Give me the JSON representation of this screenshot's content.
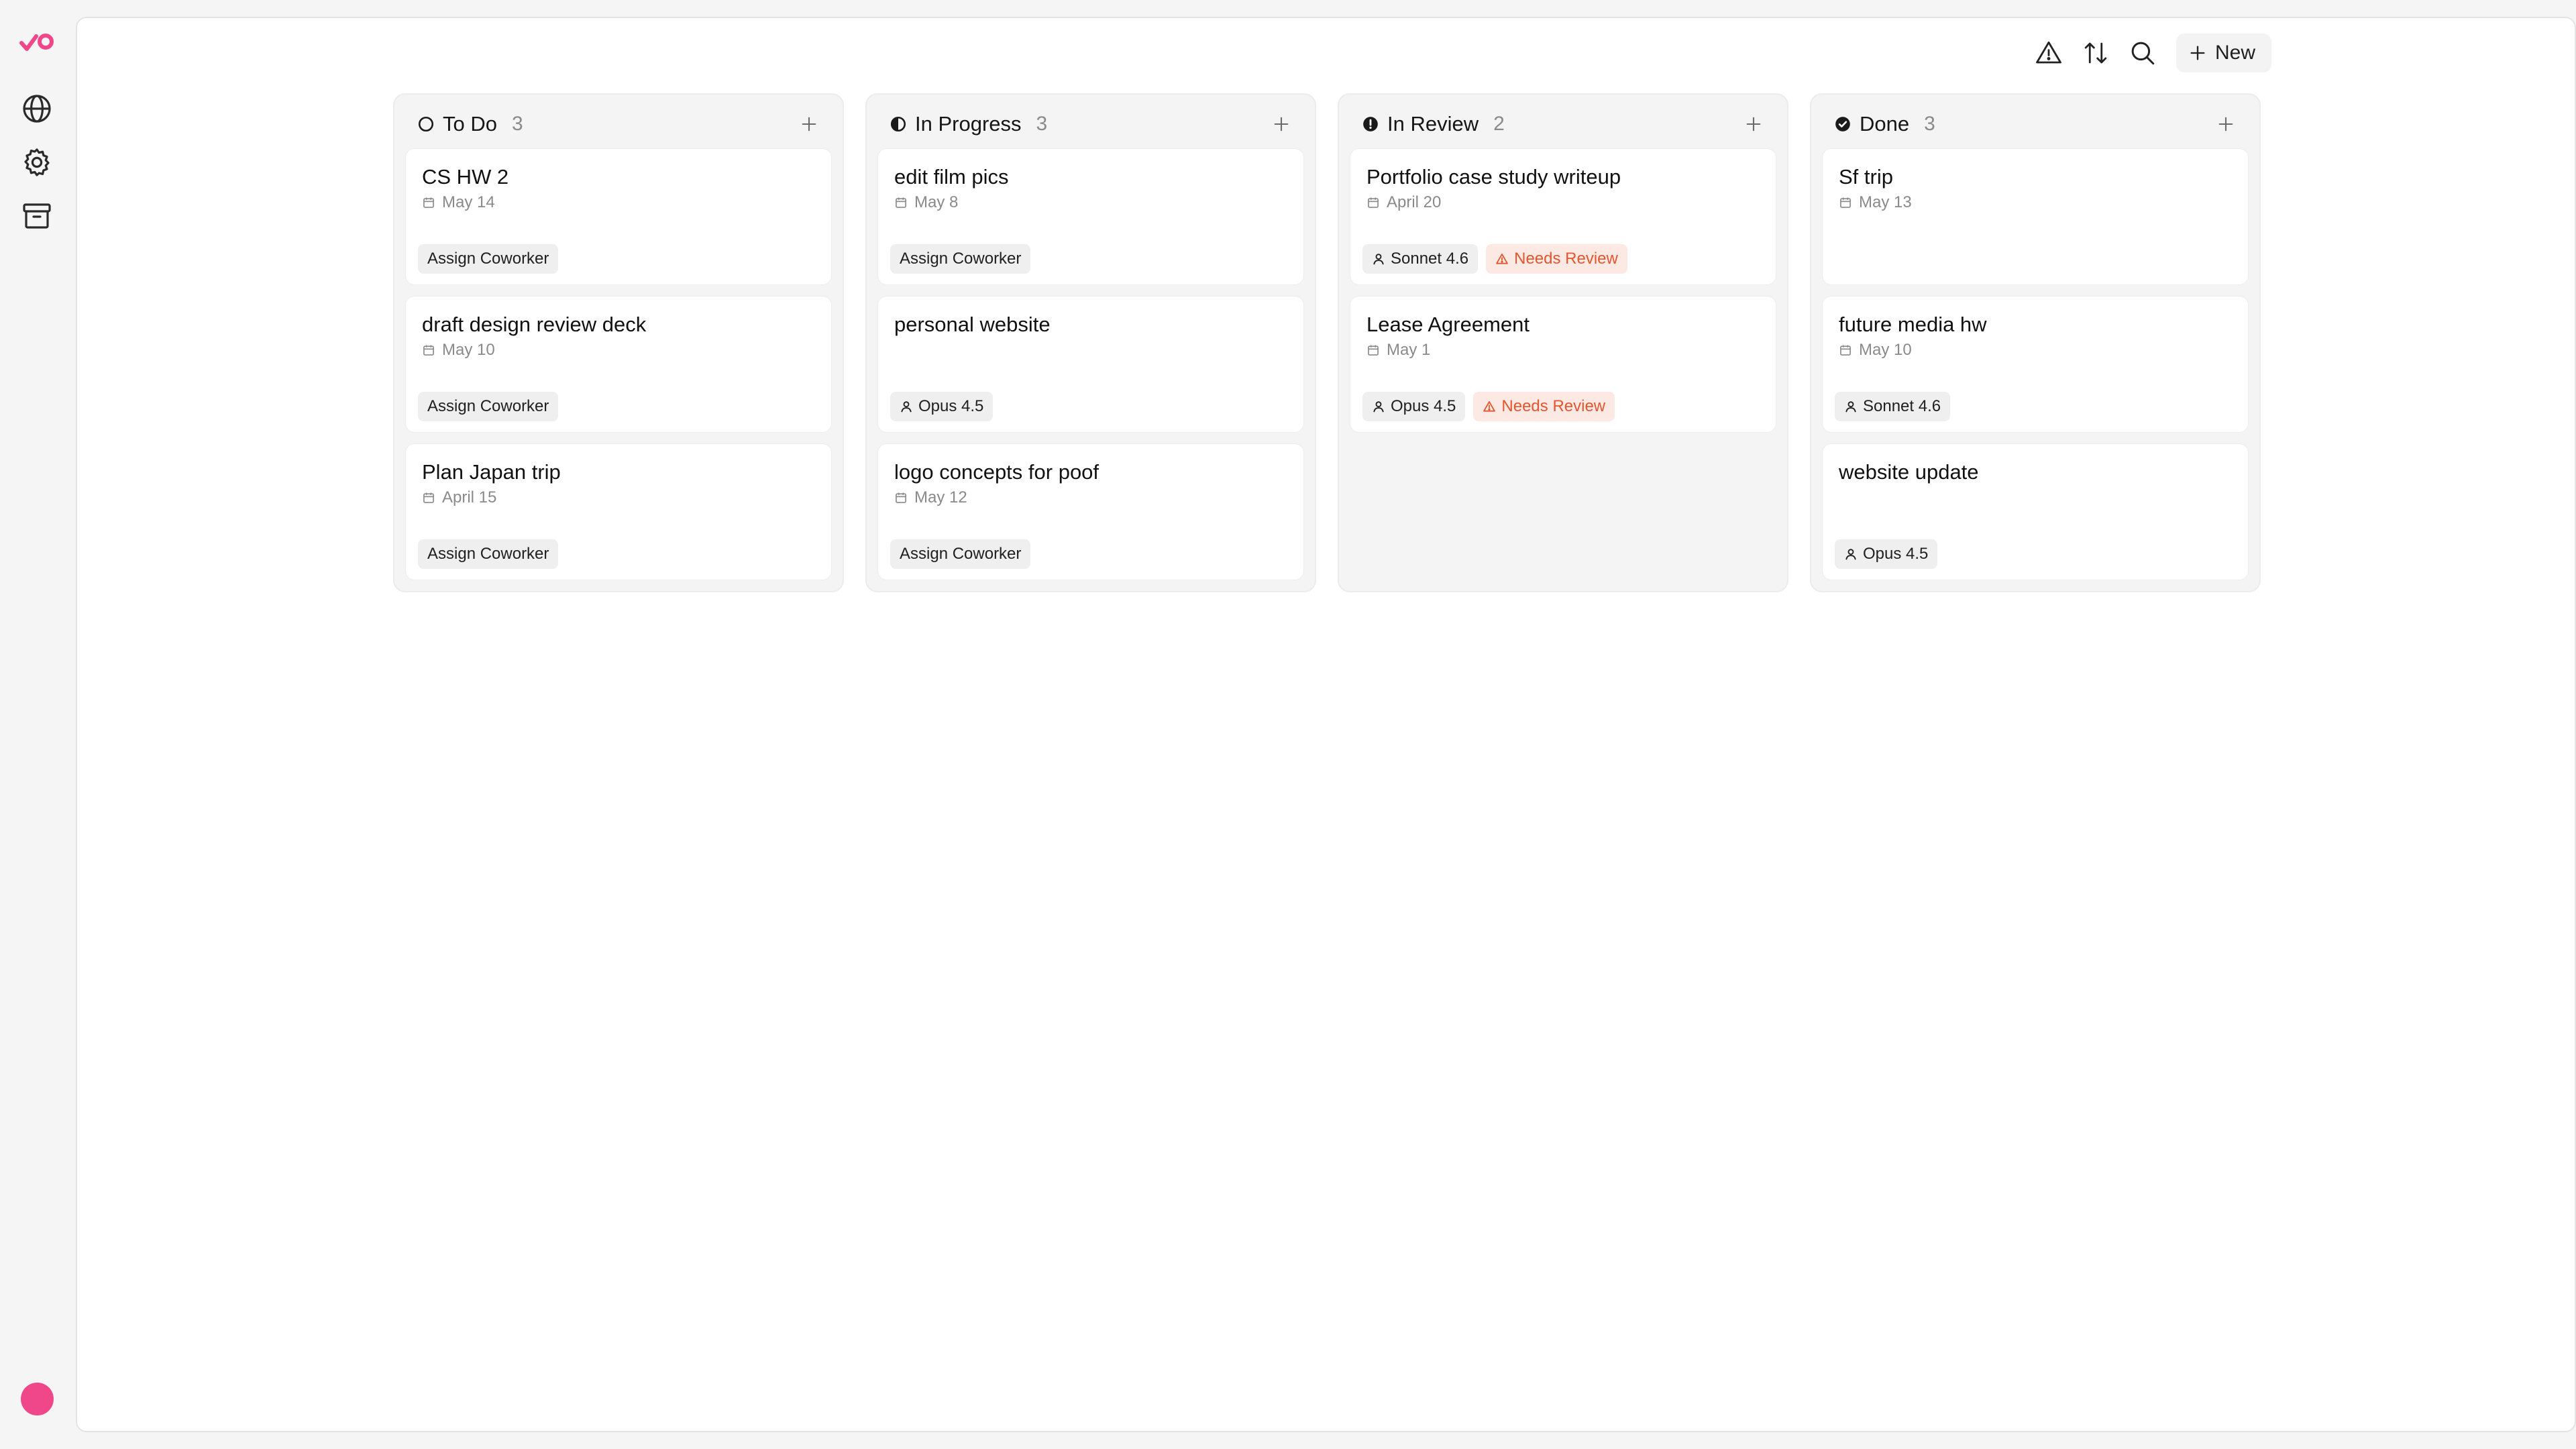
{
  "toolbar": {
    "new_label": "New"
  },
  "colors": {
    "accent": "#f0478a",
    "warning": "#e5552e"
  },
  "columns": [
    {
      "title": "To Do",
      "count": "3",
      "status_icon": "circle-empty-icon",
      "cards": [
        {
          "title": "CS HW 2",
          "date": "May 14",
          "tags": [
            {
              "label": "Assign Coworker",
              "kind": "assign"
            }
          ]
        },
        {
          "title": "draft design review deck",
          "date": "May 10",
          "tags": [
            {
              "label": "Assign Coworker",
              "kind": "assign"
            }
          ]
        },
        {
          "title": "Plan Japan trip",
          "date": "April 15",
          "tags": [
            {
              "label": "Assign Coworker",
              "kind": "assign"
            }
          ]
        }
      ]
    },
    {
      "title": "In Progress",
      "count": "3",
      "status_icon": "circle-half-icon",
      "cards": [
        {
          "title": "edit film pics",
          "date": "May 8",
          "tags": [
            {
              "label": "Assign Coworker",
              "kind": "assign"
            }
          ]
        },
        {
          "title": "personal website",
          "date": "",
          "tags": [
            {
              "label": "Opus 4.5",
              "kind": "agent"
            }
          ]
        },
        {
          "title": "logo concepts for poof",
          "date": "May 12",
          "tags": [
            {
              "label": "Assign Coworker",
              "kind": "assign"
            }
          ]
        }
      ]
    },
    {
      "title": "In Review",
      "count": "2",
      "status_icon": "circle-alert-icon",
      "cards": [
        {
          "title": "Portfolio case study writeup",
          "date": "April 20",
          "tags": [
            {
              "label": "Sonnet 4.6",
              "kind": "agent"
            },
            {
              "label": "Needs Review",
              "kind": "warn"
            }
          ]
        },
        {
          "title": "Lease Agreement",
          "date": "May 1",
          "tags": [
            {
              "label": "Opus 4.5",
              "kind": "agent"
            },
            {
              "label": "Needs Review",
              "kind": "warn"
            }
          ]
        }
      ]
    },
    {
      "title": "Done",
      "count": "3",
      "status_icon": "circle-check-icon",
      "cards": [
        {
          "title": "Sf trip",
          "date": "May 13",
          "tags": []
        },
        {
          "title": "future media hw",
          "date": "May 10",
          "tags": [
            {
              "label": "Sonnet 4.6",
              "kind": "agent"
            }
          ]
        },
        {
          "title": "website update",
          "date": "",
          "tags": [
            {
              "label": "Opus 4.5",
              "kind": "agent"
            }
          ]
        }
      ]
    }
  ]
}
